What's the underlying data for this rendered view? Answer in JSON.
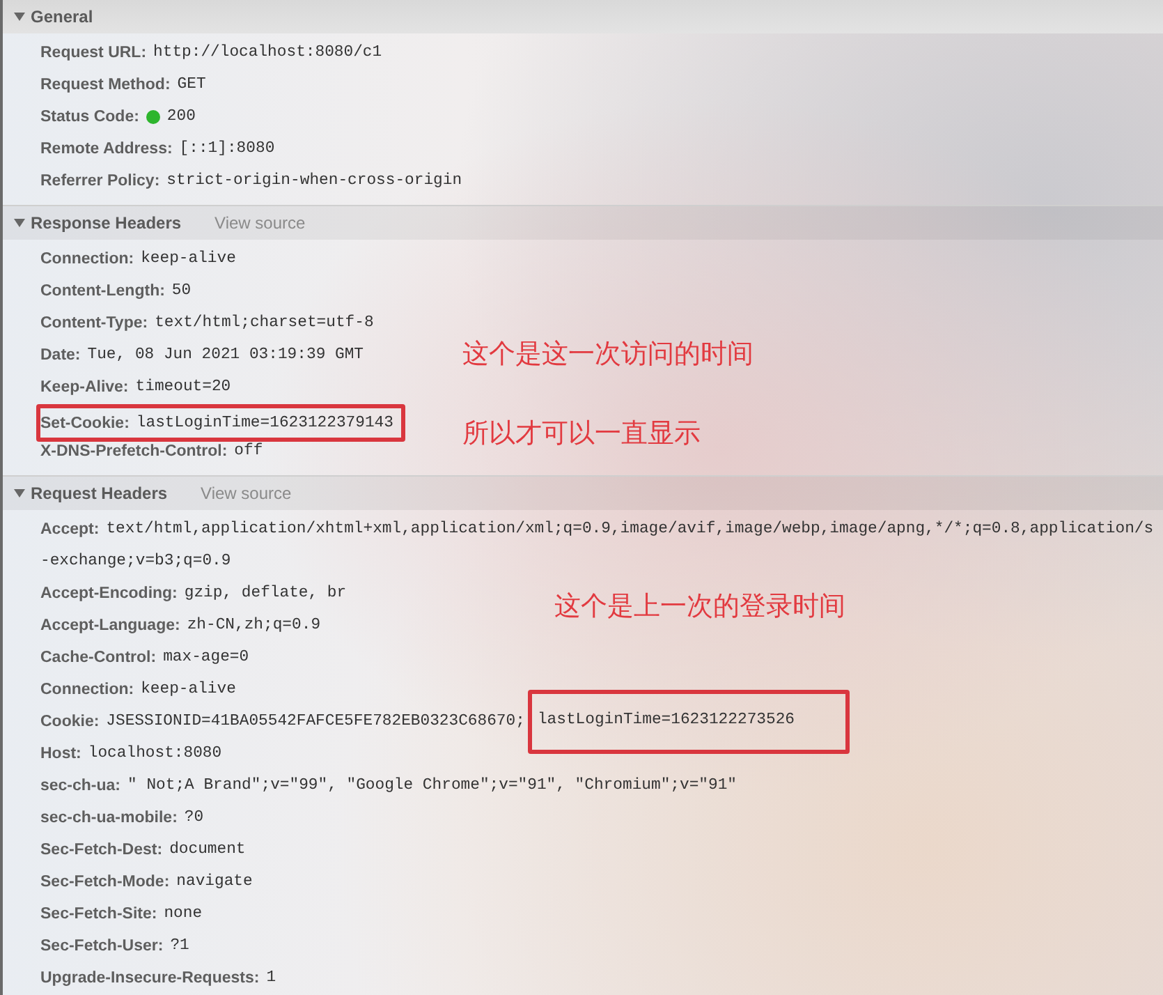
{
  "sections": [
    {
      "title": "General",
      "expanded": true,
      "rows": [
        {
          "name": "Request URL:",
          "value": "http://localhost:8080/c1",
          "boxed": false
        },
        {
          "name": "Request Method:",
          "value": "GET",
          "boxed": false
        },
        {
          "name": "Status Code:",
          "value": "200",
          "color": "#2db52d",
          "boxed": false
        },
        {
          "name": "Remote Address:",
          "value": "[::1]:8080",
          "boxed": false
        },
        {
          "name": "Referrer Policy:",
          "value": "strict-origin-when-cross-origin",
          "boxed": false
        }
      ]
    },
    {
      "title": "Response Headers",
      "link": "View source",
      "expanded": true,
      "rows": [
        {
          "name": "Connection:",
          "value": "keep-alive",
          "boxed": false
        },
        {
          "name": "Content-Length:",
          "value": "50",
          "boxed": false
        },
        {
          "name": "Content-Type:",
          "value": "text/html;charset=utf-8",
          "boxed": false
        },
        {
          "name": "Date:",
          "value": "Tue, 08 Jun 2021 03:19:39 GMT",
          "boxed": false
        },
        {
          "name": "Keep-Alive:",
          "value": "timeout=20",
          "boxed": false
        },
        {
          "name": "Set-Cookie:",
          "value": "lastLoginTime=1623122379143",
          "boxed": true
        },
        {
          "name": "X-DNS-Prefetch-Control:",
          "value": "off",
          "boxed": false
        }
      ]
    },
    {
      "title": "Request Headers",
      "link": "View source",
      "expanded": true,
      "rows": [
        {
          "name": "Accept:",
          "value": "text/html,application/xhtml+xml,application/xml;q=0.9,image/avif,image/webp,image/apng,*/*;q=0.8,application/s",
          "continuation": "-exchange;v=b3;q=0.9",
          "boxed": false
        },
        {
          "name": "Accept-Encoding:",
          "value": "gzip, deflate, br",
          "boxed": false
        },
        {
          "name": "Accept-Language:",
          "value": "zh-CN,zh;q=0.9",
          "boxed": false
        },
        {
          "name": "Cache-Control:",
          "value": "max-age=0",
          "boxed": false
        },
        {
          "name": "Connection:",
          "value": "keep-alive",
          "boxed": false
        },
        {
          "name": "Cookie:",
          "value": "JSESSIONID=41BA05542FAFCE5FE782EB0323C68670;",
          "value_boxed": "lastLoginTime=1623122273526",
          "boxed": false
        },
        {
          "name": "Host:",
          "value": "localhost:8080",
          "boxed": false
        },
        {
          "name": "sec-ch-ua:",
          "value": "\" Not;A Brand\";v=\"99\", \"Google Chrome\";v=\"91\", \"Chromium\";v=\"91\"",
          "boxed": false
        },
        {
          "name": "sec-ch-ua-mobile:",
          "value": "?0",
          "boxed": false
        },
        {
          "name": "Sec-Fetch-Dest:",
          "value": "document",
          "boxed": false
        },
        {
          "name": "Sec-Fetch-Mode:",
          "value": "navigate",
          "boxed": false
        },
        {
          "name": "Sec-Fetch-Site:",
          "value": "none",
          "boxed": false
        },
        {
          "name": "Sec-Fetch-User:",
          "value": "?1",
          "boxed": false
        },
        {
          "name": "Upgrade-Insecure-Requests:",
          "value": "1",
          "boxed": false
        }
      ]
    }
  ],
  "annotations": [
    {
      "text": "这个是这一次访问的时间"
    },
    {
      "text": "所以才可以一直显示"
    },
    {
      "text": "这个是上一次的登录时间"
    }
  ]
}
